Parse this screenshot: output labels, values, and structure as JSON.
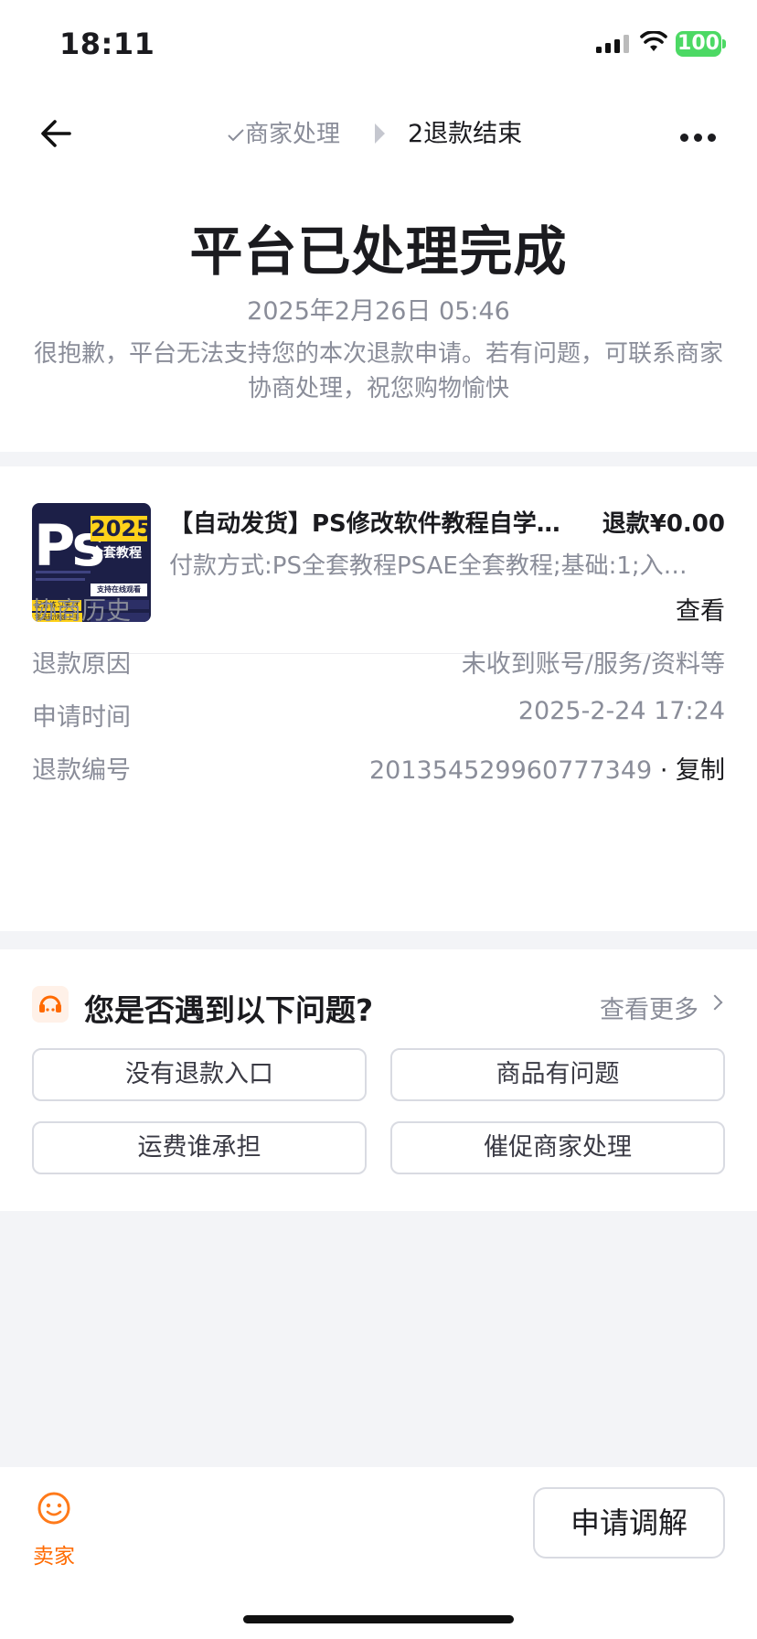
{
  "status_bar": {
    "time": "18:11",
    "battery": "100"
  },
  "nav": {
    "step1_label": "商家处理",
    "step2_label": "2退款结束"
  },
  "header": {
    "title": "平台已处理完成",
    "datetime": "2025年2月26日 05:46",
    "description": "很抱歉，平台无法支持您的本次退款申请。若有问题，可联系商家协商处理，祝您购物愉快"
  },
  "product": {
    "thumb_text": "Ps",
    "thumb_year": "2025",
    "thumb_sub": "全套教程",
    "thumb_pill": "支持在线观看",
    "thumb_tag1": "配套练习素材",
    "thumb_tag2": "零基础快速上手",
    "title": "【自动发货】PS修改软件教程自学…",
    "amount": "退款¥0.00",
    "spec": "付款方式:PS全套教程PSAE全套教程;基础:1;入…"
  },
  "details": {
    "history_label": "协商历史",
    "history_action": "查看",
    "reason_label": "退款原因",
    "reason_value": "未收到账号/服务/资料等",
    "time_label": "申请时间",
    "time_value": "2025-2-24 17:24",
    "number_label": "退款编号",
    "number_value": "201354529960777349",
    "copy_label": "复制",
    "separator": "·"
  },
  "questions": {
    "title": "您是否遇到以下问题?",
    "more_label": "查看更多",
    "buttons": [
      "没有退款入口",
      "商品有问题",
      "运费谁承担",
      "催促商家处理"
    ]
  },
  "bottom_bar": {
    "seller_label": "卖家",
    "mediate_label": "申请调解"
  },
  "colors": {
    "accent": "#ff6a00",
    "battery": "#4cd964",
    "muted": "#8a8d99"
  }
}
